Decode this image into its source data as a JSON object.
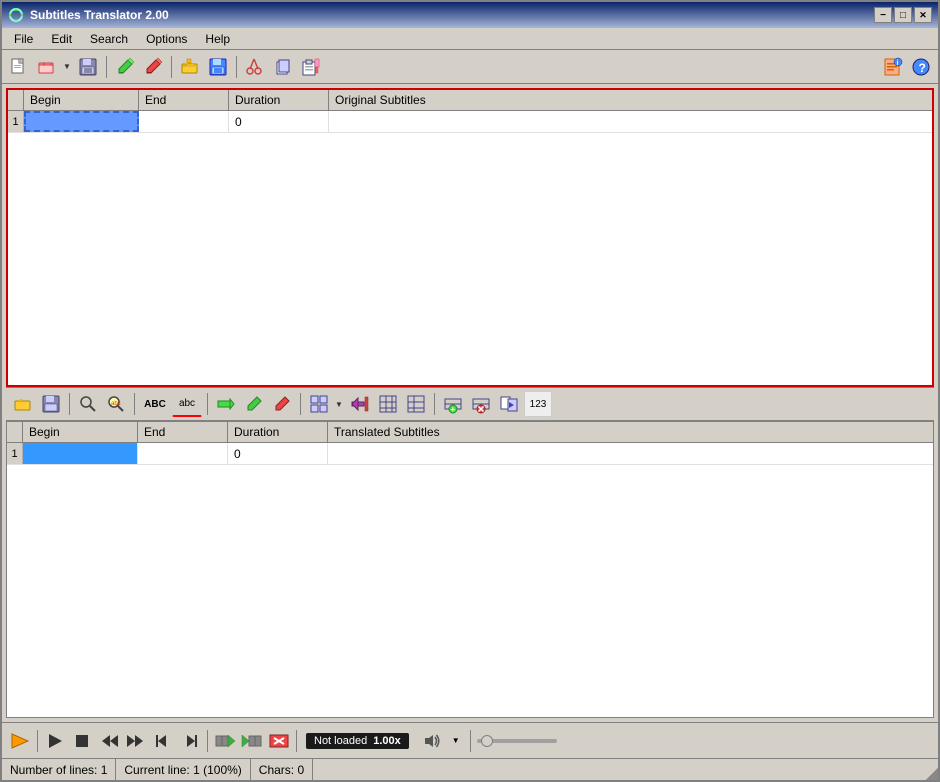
{
  "window": {
    "title": "Subtitles Translator 2.00",
    "title_icon": "♻",
    "controls": {
      "minimize": "−",
      "maximize": "□",
      "close": "✕"
    }
  },
  "menu": {
    "items": [
      "File",
      "Edit",
      "Search",
      "Options",
      "Help"
    ]
  },
  "toolbar_top": {
    "buttons": [
      {
        "name": "new",
        "icon": "📄"
      },
      {
        "name": "open",
        "icon": "📂"
      },
      {
        "name": "save",
        "icon": "💾"
      },
      {
        "name": "edit1",
        "icon": "✏"
      },
      {
        "name": "edit2",
        "icon": "📝"
      },
      {
        "name": "open2",
        "icon": "📂"
      },
      {
        "name": "save2",
        "icon": "💾"
      },
      {
        "name": "cut",
        "icon": "✂"
      },
      {
        "name": "copy",
        "icon": "📋"
      },
      {
        "name": "paste",
        "icon": "📋"
      }
    ],
    "right_buttons": [
      {
        "name": "info",
        "icon": "📋"
      },
      {
        "name": "help",
        "icon": "❓"
      }
    ]
  },
  "top_table": {
    "columns": [
      "",
      "Begin",
      "End",
      "Duration",
      "Original Subtitles"
    ],
    "rows": [
      {
        "num": "1",
        "begin": "",
        "end": "",
        "duration": "0",
        "text": ""
      }
    ]
  },
  "mid_toolbar": {
    "buttons": [
      {
        "name": "open-folder",
        "icon": "📂"
      },
      {
        "name": "save-mid",
        "icon": "💾"
      },
      {
        "name": "search-mag",
        "icon": "🔍"
      },
      {
        "name": "search-mag2",
        "icon": "🔍"
      },
      {
        "name": "abc",
        "icon": "ABC"
      },
      {
        "name": "abc2",
        "icon": "abc"
      },
      {
        "name": "arrow-right",
        "icon": "➡"
      },
      {
        "name": "pencil-green",
        "icon": "✏"
      },
      {
        "name": "pencil-red",
        "icon": "✏"
      },
      {
        "name": "grid",
        "icon": "▦"
      },
      {
        "name": "arrow-left-bar",
        "icon": "⬅"
      },
      {
        "name": "grid2",
        "icon": "⊞"
      },
      {
        "name": "grid3",
        "icon": "⊟"
      },
      {
        "name": "add-row",
        "icon": "➕"
      },
      {
        "name": "delete-row",
        "icon": "✕"
      },
      {
        "name": "copy2",
        "icon": "📋"
      },
      {
        "name": "num",
        "icon": "123"
      }
    ]
  },
  "bottom_table": {
    "columns": [
      "",
      "Begin",
      "End",
      "Duration",
      "Translated Subtitles"
    ],
    "rows": [
      {
        "num": "1",
        "begin": "",
        "end": "",
        "duration": "0",
        "text": ""
      }
    ]
  },
  "player": {
    "buttons": [
      {
        "name": "player-open",
        "icon": "📂",
        "color": "#f90"
      },
      {
        "name": "play",
        "icon": "▶"
      },
      {
        "name": "stop",
        "icon": "⏹"
      },
      {
        "name": "rewind",
        "icon": "⏪"
      },
      {
        "name": "fast-forward",
        "icon": "⏩"
      },
      {
        "name": "prev-frame",
        "icon": "⏮"
      },
      {
        "name": "next-frame",
        "icon": "⏭"
      },
      {
        "name": "mark-in",
        "icon": "⬛"
      },
      {
        "name": "mark-out",
        "icon": "⬛"
      },
      {
        "name": "export",
        "icon": "⬛"
      }
    ],
    "not_loaded_label": "Not loaded",
    "speed_label": "1.00x",
    "stop_btn": "⏹",
    "dropdown_btn": "▼"
  },
  "status_bar": {
    "num_lines_label": "Number of lines: 1",
    "current_line_label": "Current line: 1 (100%)",
    "chars_label": "Chars: 0"
  }
}
